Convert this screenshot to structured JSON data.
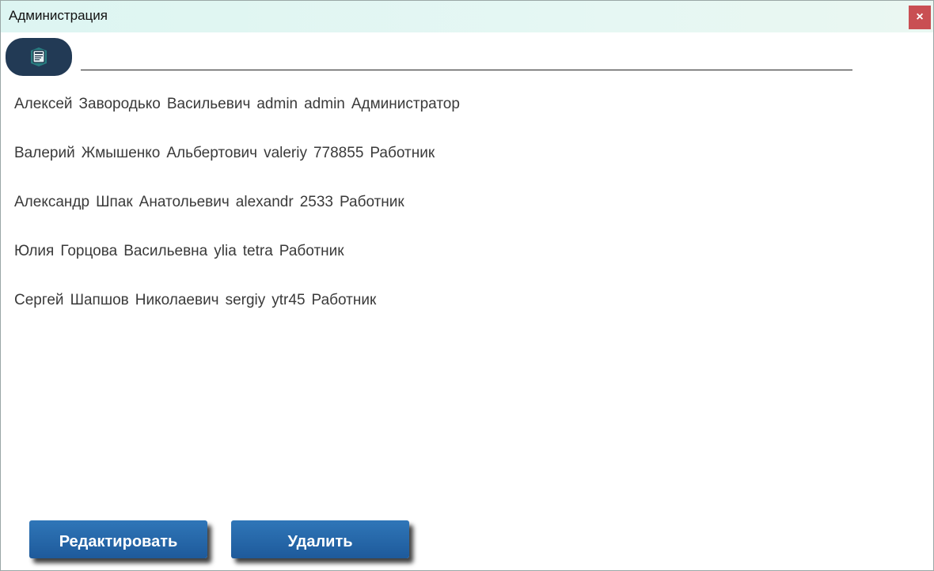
{
  "window": {
    "title": "Администрация",
    "close_label": "×"
  },
  "search": {
    "value": "",
    "placeholder": ""
  },
  "users": [
    {
      "first_name": "Алексей",
      "last_name": "Завородько",
      "patronymic": "Васильевич",
      "login": "admin",
      "password": "admin",
      "role": "Администратор"
    },
    {
      "first_name": "Валерий",
      "last_name": "Жмышенко",
      "patronymic": "Альбертович",
      "login": "valeriy",
      "password": "778855",
      "role": "Работник"
    },
    {
      "first_name": "Александр",
      "last_name": "Шпак",
      "patronymic": "Анатольевич",
      "login": "alexandr",
      "password": "2533",
      "role": "Работник"
    },
    {
      "first_name": "Юлия",
      "last_name": "Горцова",
      "patronymic": "Васильевна",
      "login": "ylia",
      "password": "tetra",
      "role": "Работник"
    },
    {
      "first_name": "Сергей",
      "last_name": "Шапшов",
      "patronymic": "Николаевич",
      "login": "sergiy",
      "password": "ytr45",
      "role": "Работник"
    }
  ],
  "buttons": {
    "edit": "Редактировать",
    "delete": "Удалить"
  },
  "icons": {
    "search_button": "search-icon"
  }
}
